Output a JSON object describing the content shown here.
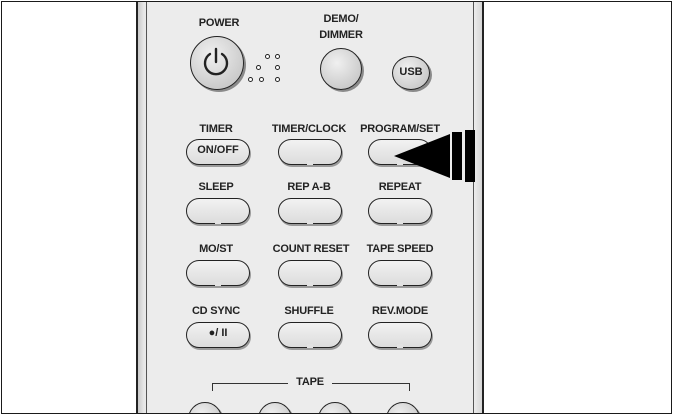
{
  "buttons": {
    "power": "POWER",
    "demo_dimmer_line1": "DEMO/",
    "demo_dimmer_line2": "DIMMER",
    "usb": "USB",
    "timer": "TIMER",
    "timer_on_off": "ON/OFF",
    "timer_clock": "TIMER/CLOCK",
    "program_set": "PROGRAM/SET",
    "sleep": "SLEEP",
    "rep_ab": "REP A-B",
    "repeat": "REPEAT",
    "mo_st": "MO/ST",
    "count_reset": "COUNT RESET",
    "tape_speed": "TAPE SPEED",
    "cd_sync": "CD SYNC",
    "cd_sync_symbol": "●/ II",
    "shuffle": "SHUFFLE",
    "rev_mode": "REV.MODE",
    "tape": "TAPE"
  },
  "icons": [
    "power-icon",
    "indicator-arrow-icon",
    "record-pause-icon"
  ],
  "colors": {
    "outline": "#222222",
    "body": "#ececec",
    "arrow": "#000000"
  }
}
